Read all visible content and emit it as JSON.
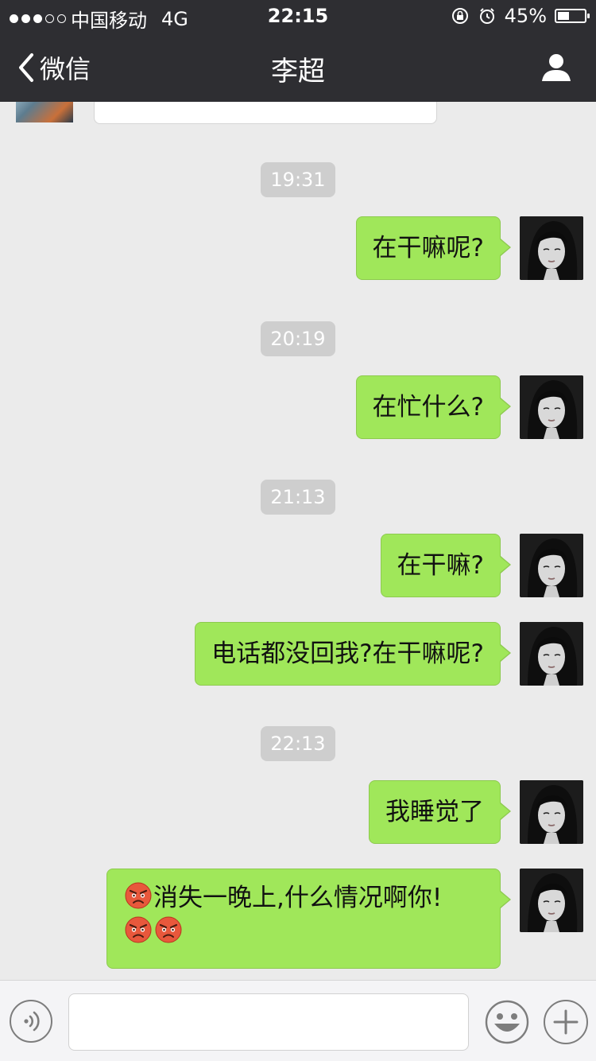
{
  "status_bar": {
    "carrier": "中国移动",
    "network": "4G",
    "time": "22:15",
    "battery_percent": "45%",
    "battery_level": 0.45,
    "signal_filled": 3,
    "signal_total": 5
  },
  "nav": {
    "back_label": "微信",
    "title": "李超"
  },
  "chat": {
    "messages": [
      {
        "timestamp": "19:31",
        "text": "在干嘛呢?"
      },
      {
        "timestamp": "20:19",
        "text": "在忙什么?"
      },
      {
        "timestamp": "21:13",
        "text": "在干嘛?"
      },
      {
        "text": "电话都没回我?在干嘛呢?"
      },
      {
        "timestamp": "22:13",
        "text": "我睡觉了"
      },
      {
        "text_line1": "消失一晚上,什么情况啊你!",
        "emoji": "angry-face",
        "emoji_count_line1": 1,
        "emoji_count_line2": 2
      }
    ]
  },
  "input": {
    "placeholder": ""
  },
  "colors": {
    "bar_bg": "#2e2e32",
    "chat_bg": "#ebebeb",
    "sent_bubble": "#a0e75a",
    "timestamp_bg": "#cecece"
  }
}
